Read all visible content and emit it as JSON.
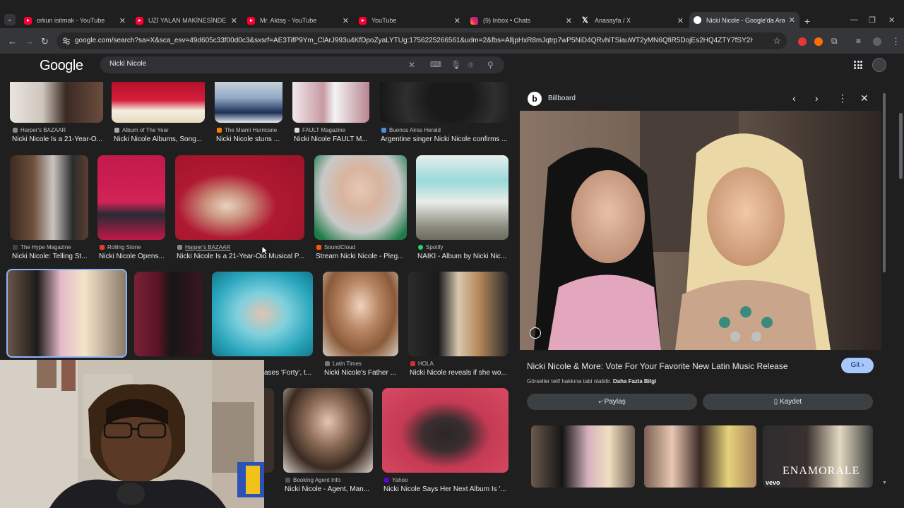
{
  "browser": {
    "tabs": [
      {
        "title": "orkun isitmak - YouTube",
        "icon": "youtube-icon",
        "active": false
      },
      {
        "title": "UZİ YALAN MAKİNESİNDE! | #P",
        "icon": "youtube-icon",
        "active": false
      },
      {
        "title": "Mr. Aktaş - YouTube",
        "icon": "youtube-icon",
        "active": false
      },
      {
        "title": "YouTube",
        "icon": "youtube-icon",
        "active": false
      },
      {
        "title": "(9) Inbox • Chats",
        "icon": "instagram-icon",
        "active": false
      },
      {
        "title": "Anasayfa / X",
        "icon": "x-icon",
        "active": false
      },
      {
        "title": "Nicki Nicole - Google'da Ara",
        "icon": "google-icon",
        "active": true
      }
    ],
    "url": "google.com/search?sa=X&sca_esv=49d605c33f00d0c3&sxsrf=AE3TifP9Ym_ClArJ993u4KfDpoZyaLYTUg:1756225266561&udm=2&fbs=AlljpHxR8mJqtrp7wP5NiD4QRvhlTSiauWT2yMN6QfiR5DojEs2HQ4ZTY7fSY2HTYuVi6ksaT51I3e7engzf1...",
    "ext_colors": [
      "#e53935",
      "#ff6f00"
    ]
  },
  "google": {
    "logo": "Google",
    "query": "Nicki Nicole"
  },
  "grid": {
    "row1": [
      {
        "source": "Harper's BAZAAR",
        "caption": "Nicki Nicole Is a 21-Year-O..."
      },
      {
        "source": "Album of The Year",
        "caption": "Nicki Nicole Albums, Song..."
      },
      {
        "source": "The Miami Hurricane",
        "caption": "Nicki Nicole stuns ..."
      },
      {
        "source": "FAULT Magazine",
        "caption": "Nicki Nicole FAULT M..."
      },
      {
        "source": "Buenos Aires Herald",
        "caption": "Argentine singer Nicki Nicole confirms ..."
      }
    ],
    "row2": [
      {
        "source": "The Hype Magazine",
        "caption": "Nicki Nicole: Telling St..."
      },
      {
        "source": "Rolling Stone",
        "caption": "Nicki Nicole Opens..."
      },
      {
        "source": "Harper's BAZAAR",
        "caption": "Nicki Nicole Is a 21-Year-Old Musical P..."
      },
      {
        "source": "SoundCloud",
        "caption": "Stream Nicki Nicole - Pleg..."
      },
      {
        "source": "Spotify",
        "caption": "NAIKI - Album by Nicki Nic..."
      }
    ],
    "row3": [
      {
        "source": "",
        "caption": ""
      },
      {
        "source": "",
        "caption": ""
      },
      {
        "source": "",
        "caption": "ases 'Forty', t..."
      },
      {
        "source": "Latin Times",
        "caption": "Nicki Nicole's Father ..."
      },
      {
        "source": "HOLA",
        "caption": "Nicki Nicole reveals if she wo..."
      }
    ],
    "row4": [
      {
        "source": "Booking Agent Info",
        "caption": "Nicki Nicole - Agent, Man..."
      },
      {
        "source": "Yahoo",
        "caption": "Nicki Nicole Says Her Next Album Is '..."
      }
    ]
  },
  "panel": {
    "source_initial": "b",
    "source": "Billboard",
    "title": "Nicki Nicole & More: Vote For Your Favorite New Latin Music Release",
    "visit_label": "Git ›",
    "note": "Görseller telif hakkına tabi olabilir.",
    "note_link": "Daha Fazla Bilgi",
    "share_label": "⤶ Paylaş",
    "save_label": "Kaydet",
    "related_overlay": "ENAMORALE",
    "vevo": "vevo"
  },
  "colors": {
    "accent": "#a8c7fa",
    "page_bg": "#1f1f1f"
  }
}
